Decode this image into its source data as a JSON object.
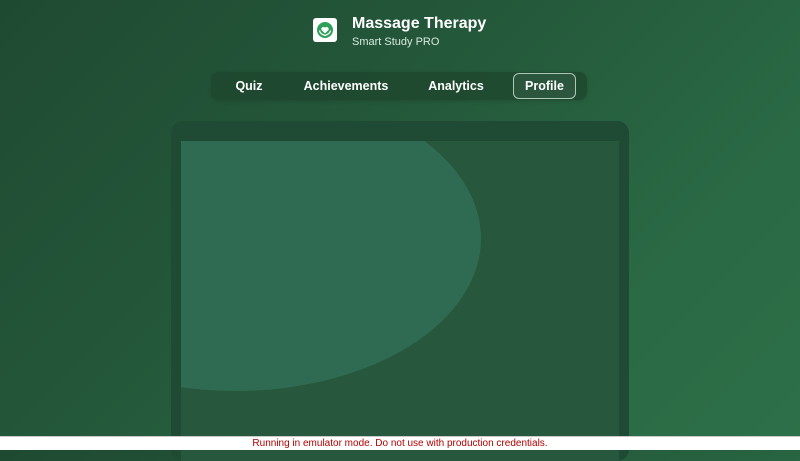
{
  "header": {
    "title": "Massage Therapy",
    "subtitle": "Smart Study PRO",
    "icon": "heart-hands-icon",
    "icon_color": "#2e9e5b"
  },
  "nav": {
    "tabs": [
      {
        "label": "Quiz",
        "active": false
      },
      {
        "label": "Achievements",
        "active": false
      },
      {
        "label": "Analytics",
        "active": false
      },
      {
        "label": "Profile",
        "active": true
      }
    ]
  },
  "banner": {
    "text": "Running in emulator mode. Do not use with production credentials.",
    "color": "#b00000"
  },
  "colors": {
    "background": "#24583a",
    "accent": "#2e6b52"
  }
}
